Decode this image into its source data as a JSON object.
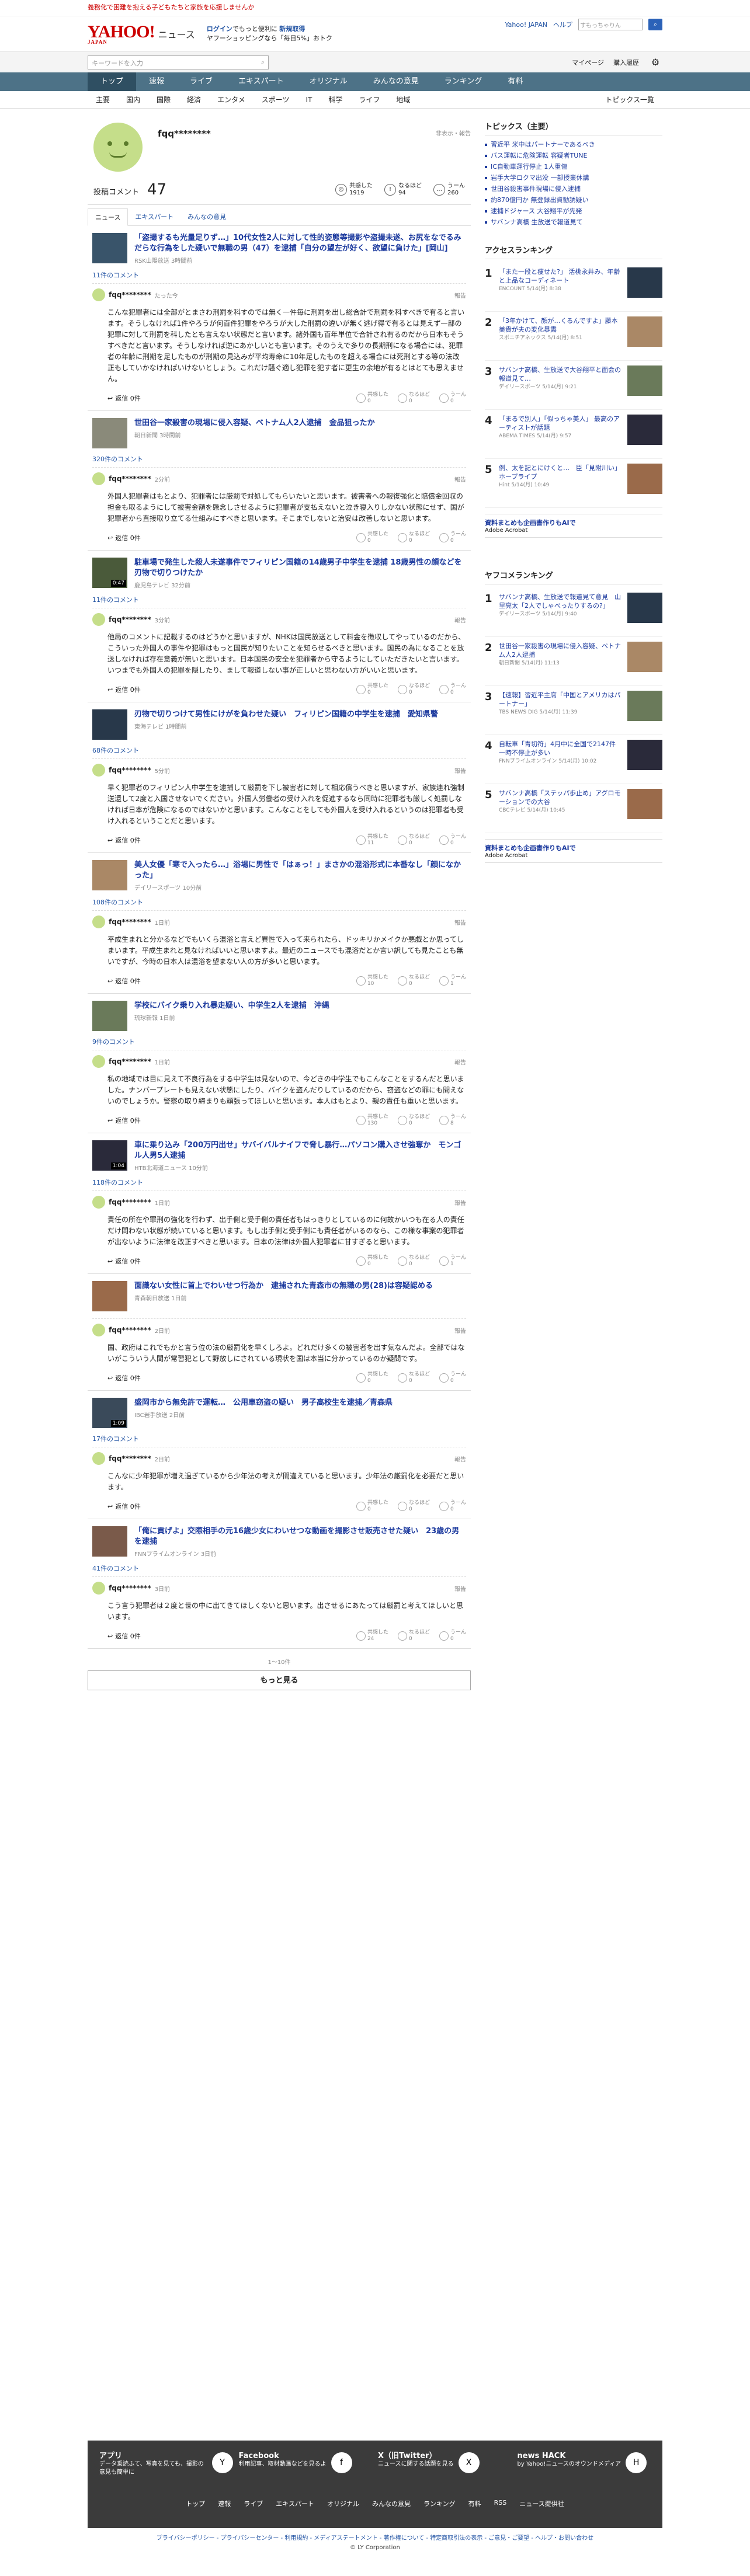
{
  "topbar": {
    "text": "義務化で困難を抱える子どもたちと家族を応援しませんか"
  },
  "header": {
    "logo": "YAHOO!",
    "logo_sub": "JAPAN",
    "news": "ニュース",
    "promo1": "ログイン",
    "promo1b": "でもっと便利に",
    "promo1c": "新規取得",
    "promo2": "ヤフーショッピングなら「毎日5%」おトク",
    "links": [
      "Yahoo! JAPAN",
      "ヘルプ"
    ],
    "search_ph": "すもっちゃりん"
  },
  "search": {
    "placeholder": "キーワードを入力",
    "mypage": "マイページ",
    "login": "購入履歴"
  },
  "nav": [
    "トップ",
    "速報",
    "ライブ",
    "エキスパート",
    "オリジナル",
    "みんなの意見",
    "ランキング",
    "有料"
  ],
  "subnav": [
    "主要",
    "国内",
    "国際",
    "経済",
    "エンタメ",
    "スポーツ",
    "IT",
    "科学",
    "ライフ",
    "地域"
  ],
  "subnav_right": "トピックス一覧",
  "profile": {
    "name": "fqq********",
    "score_label": "非表示・報告",
    "comment_label": "投稿コメント",
    "comment_count": "47",
    "stats": [
      {
        "label": "共感した",
        "value": "1919",
        "icon": "◎"
      },
      {
        "label": "なるほど",
        "value": "94",
        "icon": "!"
      },
      {
        "label": "うーん",
        "value": "260",
        "icon": "…"
      }
    ]
  },
  "tabs": [
    "ニュース",
    "エキスパート",
    "みんなの意見"
  ],
  "items": [
    {
      "title": "「盗撮するも光量足りず…」10代女性2人に対して性的姿態等撮影や盗撮未遂、お尻をなでるみだらな行為をした疑いで無職の男（47）を逮捕「自分の望左が好く、欲望に負けた」[岡山]",
      "src": "RSK山陽放送 3時間前",
      "count": "11件のコメント",
      "dur": "",
      "user": "fqq********",
      "time": "たった今",
      "text": "こんな犯罪者には全部がとまさわ刑罰を科すのでは無く一件毎に刑罰を出し総合計で刑罰を科すべきで有ると言います。そうしなければ1件やろうが何百件犯罪をやろうが大した刑罰の違いが無く逃げ得で有るとは見えず一部の犯罪に対して刑罰を科したとも言えない状態だと言います。諸外国も百年単位で合計され有るのだから日本もそうすべきだと言います。そうしなければ逆にあかしいとも言います。そのうえで多りの長期刑になる場合には、犯罪者の年齢に刑期を足したものが刑期の見込みが平均寿命に10年足したものを超える場合には死刑とする等の法改正もしていかなければいけないとしょう。これだけ騒ぐ適し犯罪を犯す者に更生の余地が有るとはとても思えません。",
      "r": [
        "0",
        "0",
        "0"
      ]
    },
    {
      "title": "世田谷一家殺害の現場に侵入容疑、ベトナム人2人逮捕　金品狙ったか",
      "src": "朝日新聞 3時間前",
      "count": "320件のコメント",
      "dur": "",
      "user": "fqq********",
      "time": "2分前",
      "text": "外国人犯罪者はもとより、犯罪者には厳罰で対処してもらいたいと思います。被害者への報復強化と賠償金回収の担金も取るようにして被害金額を懸念しさせるように犯罪者が支払えないと泣き寝入りしかない状態にせず、国が犯罪者から直接取り立てる仕組みにすべきと思います。そこまでしないと治安は改善しないと思います。",
      "r": [
        "0",
        "0",
        "0"
      ]
    },
    {
      "title": "駐車場で発生した殺人未遂事件でフィリピン国籍の14歳男子中学生を逮捕 18歳男性の顔などを刃物で切りつけたか",
      "src": "鹿児島テレビ 32分前",
      "count": "11件のコメント",
      "dur": "0:47",
      "user": "fqq********",
      "time": "3分前",
      "text": "他局のコメントに記載するのはどうかと思いますが、NHKは国民放送として料金を徴収してやっているのだから、こういった外国人の事件や犯罪はもっと国民が知りたいことを知らせるべきと思います。国民の為になることを放送しなければ存在意義が無いと思います。日本国民の安全を犯罪者から守るようにしていただきたいと言います。いつまでも外国人の犯罪を隠したり、まして報道しない事が正しいと思わない方がいいと思います。",
      "r": [
        "0",
        "0",
        "0"
      ]
    },
    {
      "title": "刃物で切りつけて男性にけがを負わせた疑い　フィリピン国籍の中学生を逮捕　愛知県警",
      "src": "東海テレビ 1時間前",
      "count": "68件のコメント",
      "dur": "",
      "user": "fqq********",
      "time": "5分前",
      "text": "早く犯罪者のフィリピン人中学生を逮捕して厳罰を下し被害者に対して相応償うべきと思いますが、家族連れ強制送還して2度と入国させないでください。外国人労働者の受け入れを促進するなら同時に犯罪者も厳しく処罰しなければ日本が危険になるのではないかと思います。こんなことをしても外国人を受け入れるというのは犯罪者も受け入れるということだと思います。",
      "r": [
        "11",
        "0",
        "0"
      ]
    },
    {
      "title": "美人女優「寒で入ったら…」浴場に男性で「はぁっ！」まさかの混浴形式に本番なし「顔になかった」",
      "src": "デイリースポーツ 10分前",
      "count": "108件のコメント",
      "dur": "",
      "user": "fqq********",
      "time": "1日前",
      "text": "平成生まれと分かるなどでもいくら混浴と言えど異性で入って来られたら、ドッキリかメイクか悪戯とか思ってしまいます。平成生まれと見なければいいと思いますよ。最近のニュースでも混浴だとか言い訳しても見たことも無いですが、今時の日本人は混浴を望まない人の方が多いと思います。",
      "r": [
        "10",
        "0",
        "1"
      ]
    },
    {
      "title": "学校にバイク乗り入れ暴走疑い、中学生2人を逮捕　沖縄",
      "src": "琉球新報 1日前",
      "count": "9件のコメント",
      "dur": "",
      "user": "fqq********",
      "time": "1日前",
      "text": "私の地域では目に見えて不良行為をする中学生は見ないので、今どきの中学生でもこんなことをするんだと思いました。ナンバープレートも見えない状態にしたり、バイクを盗んだりしているのだから、窃盗などの罪にも問えないのでしょうか。警察の取り締まりも頑張ってほしいと思います。本人はもとより、親の責任も重いと思います。",
      "r": [
        "130",
        "0",
        "8"
      ]
    },
    {
      "title": "車に乗り込み「200万円出せ」サバイバルナイフで脅し暴行…パソコン購入させ強奪か　モンゴル人男5人逮捕",
      "src": "HTB北海道ニュース 10分前",
      "count": "118件のコメント",
      "dur": "1:04",
      "user": "fqq********",
      "time": "1日前",
      "text": "責任の所在や罪刑の強化を行わず、出手側と受手側の責任者もはっきりとしているのに何故かいつも在る人の責任だけ問わない状態が続いていると思います。もし出手側と受手側にも責任者がいるのなら、この様な事案の犯罪者が出ないように法律を改正すべきと思います。日本の法律は外国人犯罪者に甘すぎると思います。",
      "r": [
        "0",
        "0",
        "1"
      ]
    },
    {
      "title": "面識ない女性に首上でわいせつ行為か　逮捕された青森市の無職の男(28)は容疑認める",
      "src": "青森朝日放送 1日前",
      "count": "",
      "dur": "",
      "user": "fqq********",
      "time": "2日前",
      "text": "国、政府はこれでもかと言う位の法の厳罰化を早くしろよ。どれだけ多くの被害者を出す気なんだよ。全部ではないがこういう人間が常習犯として野放しにされている現状を国は本当に分かっているのか疑問です。",
      "r": [
        "0",
        "0",
        "0"
      ]
    },
    {
      "title": "盛岡市から無免許で運転…　公用車窃盗の疑い　男子高校生を逮捕／青森県",
      "src": "IBC岩手放送 2日前",
      "count": "17件のコメント",
      "dur": "1:09",
      "user": "fqq********",
      "time": "2日前",
      "text": "こんなに少年犯罪が増え過ぎているから少年法の考えが間違えていると思います。少年法の厳罰化を必要だと思います。",
      "r": [
        "0",
        "0",
        "0"
      ]
    },
    {
      "title": "「俺に貢げよ」交際相手の元16歳少女にわいせつな動画を撮影させ販売させた疑い　23歳の男を逮捕",
      "src": "FNNプライムオンライン 3日前",
      "count": "41件のコメント",
      "dur": "",
      "user": "fqq********",
      "time": "3日前",
      "text": "こう言う犯罪者は２度と世の中に出てきてほしくないと思います。出させるにあたっては厳罰と考えてほしいと思います。",
      "r": [
        "24",
        "0",
        "0"
      ]
    }
  ],
  "list_footer": {
    "range": "1～10件",
    "more": "もっと見る"
  },
  "side": {
    "topics_title": "トピックス（主要）",
    "topics": [
      "習近平 米中はパートナーであるべき",
      "バス運転に危険運転 容疑者TUNE",
      "IC自動車運行停止 1人重傷",
      "岩手大学ロクマ出没 一部授業休講",
      "世田谷殺害事件現場に侵入逮捕",
      "約870億円か 無登録出資勧誘疑い",
      "逮捕ドジャース 大谷翔平が先発",
      "サバンナ高橋 生放送で報道見て"
    ],
    "access_title": "アクセスランキング",
    "access": [
      {
        "t": "「また一段と痩せた?」 活桃永井み、年齢と上品なコーディネート",
        "s": "ENCOUNT 5/14(月) 8:38"
      },
      {
        "t": "「3年かけて、顔が…くるんですよ」藤本美貴が夫の変化暴露",
        "s": "スポニチアネックス 5/14(月) 8:51"
      },
      {
        "t": "サバンナ高橋、生放送で大谷翔平と面会の報道見て…",
        "s": "デイリースポーツ 5/14(月) 9:21"
      },
      {
        "t": "「まるで別人」「似っちゃ美人」 最高のアーティストが話題",
        "s": "ABEMA TIMES 5/14(月) 9:57"
      },
      {
        "t": "例、太を記とにけくと…　臣「見附川い」ホープライプ",
        "s": "Hint 5/14(月) 10:49"
      }
    ],
    "ad": {
      "title": "資料まとめも企画書作りもAIで",
      "sub": "Adobe Acrobat"
    },
    "yahoo_title": "ヤフコメランキング",
    "yahoo": [
      {
        "t": "サバンナ高橋、生放送で報道見て意見　山里亮太「2人でしゃべったりするの?」",
        "s": "デイリースポーツ 5/14(月) 9:40"
      },
      {
        "t": "世田谷一家殺害の現場に侵入容疑、ベトナム人2人逮捕",
        "s": "朝日新聞 5/14(月) 11:13"
      },
      {
        "t": "【速報】習近平主席「中国とアメリカはパートナー」",
        "s": "TBS NEWS DIG 5/14(月) 11:39"
      },
      {
        "t": "自転車「青切符」4月中に全国で2147件 一時不停止が多い",
        "s": "FNNプライムオンライン 5/14(月) 10:02"
      },
      {
        "t": "サバンナ高橋「ステッパ歩止め」アグロモーションでの大谷",
        "s": "CBCテレビ 5/14(月) 10:45"
      }
    ],
    "ad2": {
      "title": "資料まとめも企画書作りもAIで",
      "sub": "Adobe Acrobat"
    }
  },
  "footer": {
    "cols": [
      {
        "t": "アプリ",
        "d": "データ乗読ふて、写真を見ても、撮影の意見も簡単に",
        "icon": "Y"
      },
      {
        "t": "Facebook",
        "d": "利用記事、取材動画などを見るよ",
        "icon": "f"
      },
      {
        "t": "X（旧Twitter）",
        "d": "ニュースに関する話題を見る",
        "icon": "X"
      },
      {
        "t": "news HACK",
        "d": "by Yahoo!ニュースのオウンドメディア",
        "icon": "H"
      }
    ],
    "links": [
      "トップ",
      "速報",
      "ライブ",
      "エキスパート",
      "オリジナル",
      "みんなの意見",
      "ランキング",
      "有料",
      "RSS",
      "ニュース提供社"
    ],
    "bottom": "プライバシーポリシー - プライバシーセンター - 利用規約 - メディアステートメント - 著作権について - 特定商取引法の表示 - ご意見・ご要望 - ヘルプ・お問い合わせ",
    "copy": "© LY Corporation"
  }
}
